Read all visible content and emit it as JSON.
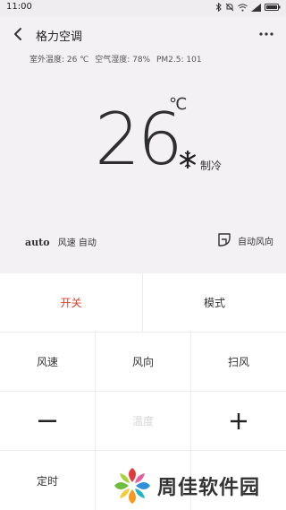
{
  "status": {
    "time": "11:00"
  },
  "header": {
    "title": "格力空调"
  },
  "env": {
    "outdoor_temp": "室外温度: 26 ℃",
    "humidity": "空气湿度: 78%",
    "pm25": "PM2.5: 101"
  },
  "display": {
    "temperature": "26",
    "unit": "℃",
    "mode": "制冷"
  },
  "fan": {
    "auto_badge": "auto",
    "label": "风速 自动"
  },
  "direction": {
    "label": "自动风向"
  },
  "controls": {
    "power": "开关",
    "mode": "模式",
    "fan_speed": "风速",
    "fan_direction": "风向",
    "swing": "扫风",
    "temp_label": "温度",
    "timer": "定时"
  },
  "watermark": {
    "text": "周佳软件园"
  },
  "colors": {
    "power_red": "#d8412f",
    "logo_green": "#6cbf3e",
    "logo_orange": "#f39a1e",
    "logo_blue": "#2f8fd8",
    "logo_red": "#e23b3b"
  }
}
